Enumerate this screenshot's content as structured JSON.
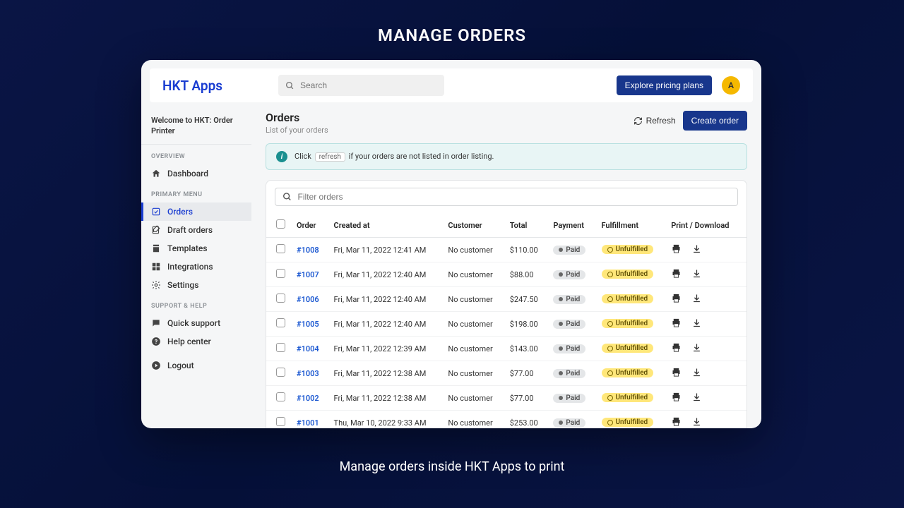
{
  "hero": {
    "title": "MANAGE ORDERS",
    "subtitle": "Manage orders inside HKT Apps to print"
  },
  "topbar": {
    "brand": "HKT Apps",
    "search_placeholder": "Search",
    "explore_btn": "Explore pricing plans",
    "avatar_initial": "A"
  },
  "sidebar": {
    "welcome": "Welcome to HKT: Order Printer",
    "sections": {
      "overview": "OVERVIEW",
      "primary": "PRIMARY MENU",
      "support": "SUPPORT & HELP"
    },
    "items": {
      "dashboard": "Dashboard",
      "orders": "Orders",
      "draft_orders": "Draft orders",
      "templates": "Templates",
      "integrations": "Integrations",
      "settings": "Settings",
      "quick_support": "Quick support",
      "help_center": "Help center",
      "logout": "Logout"
    }
  },
  "page": {
    "title": "Orders",
    "subtitle": "List of your orders",
    "refresh_btn": "Refresh",
    "create_btn": "Create order"
  },
  "banner": {
    "pre": "Click",
    "chip": "refresh",
    "post": "if your orders are not listed in order listing."
  },
  "filter": {
    "placeholder": "Filter orders"
  },
  "table": {
    "headers": {
      "order": "Order",
      "created": "Created at",
      "customer": "Customer",
      "total": "Total",
      "payment": "Payment",
      "fulfillment": "Fulfillment",
      "actions": "Print / Download"
    },
    "rows": [
      {
        "order": "#1008",
        "created": "Fri, Mar 11, 2022 12:41 AM",
        "customer": "No customer",
        "total": "$110.00",
        "payment": "Paid",
        "fulfillment": "Unfulfilled"
      },
      {
        "order": "#1007",
        "created": "Fri, Mar 11, 2022 12:40 AM",
        "customer": "No customer",
        "total": "$88.00",
        "payment": "Paid",
        "fulfillment": "Unfulfilled"
      },
      {
        "order": "#1006",
        "created": "Fri, Mar 11, 2022 12:40 AM",
        "customer": "No customer",
        "total": "$247.50",
        "payment": "Paid",
        "fulfillment": "Unfulfilled"
      },
      {
        "order": "#1005",
        "created": "Fri, Mar 11, 2022 12:40 AM",
        "customer": "No customer",
        "total": "$198.00",
        "payment": "Paid",
        "fulfillment": "Unfulfilled"
      },
      {
        "order": "#1004",
        "created": "Fri, Mar 11, 2022 12:39 AM",
        "customer": "No customer",
        "total": "$143.00",
        "payment": "Paid",
        "fulfillment": "Unfulfilled"
      },
      {
        "order": "#1003",
        "created": "Fri, Mar 11, 2022 12:38 AM",
        "customer": "No customer",
        "total": "$77.00",
        "payment": "Paid",
        "fulfillment": "Unfulfilled"
      },
      {
        "order": "#1002",
        "created": "Fri, Mar 11, 2022 12:38 AM",
        "customer": "No customer",
        "total": "$77.00",
        "payment": "Paid",
        "fulfillment": "Unfulfilled"
      },
      {
        "order": "#1001",
        "created": "Thu, Mar 10, 2022 9:33 AM",
        "customer": "No customer",
        "total": "$253.00",
        "payment": "Paid",
        "fulfillment": "Unfulfilled"
      }
    ]
  }
}
